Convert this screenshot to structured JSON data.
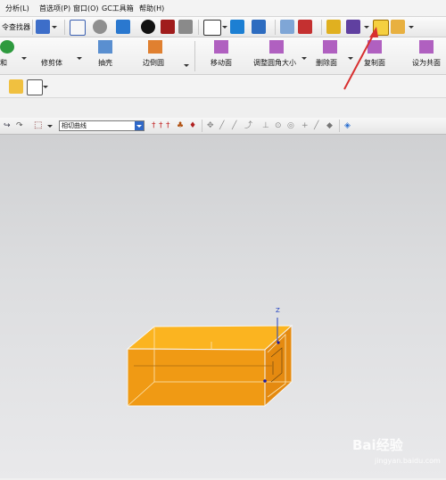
{
  "menu": {
    "items": [
      "分析(L)",
      "首选项(P)",
      "窗口(O)",
      "GC工具箱",
      "帮助(H)"
    ]
  },
  "toolbar1": {
    "finder_label": "令查找器",
    "highlight_color": "#d83030"
  },
  "ribbon": {
    "labels": [
      "和",
      "修剪体",
      "抽壳",
      "边倒圆",
      "移动面",
      "调整圆角大小",
      "删除面",
      "复制面",
      "设为共面"
    ]
  },
  "selection_bar": {
    "curve_rule": "相切曲线"
  },
  "viewport": {
    "axis_label": "Z",
    "part_color": "#f5a01a"
  },
  "watermark": {
    "text": "Bai经验",
    "sub": "jingyan.baidu.com"
  }
}
